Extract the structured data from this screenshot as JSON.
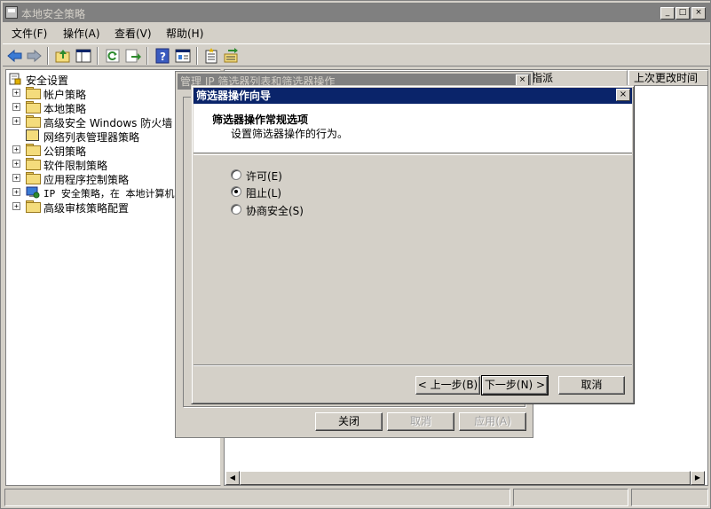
{
  "window": {
    "title": "本地安全策略",
    "min_label": "_",
    "max_label": "□",
    "close_label": "×"
  },
  "menu": [
    {
      "label": "文件(F)"
    },
    {
      "label": "操作(A)"
    },
    {
      "label": "查看(V)"
    },
    {
      "label": "帮助(H)"
    }
  ],
  "tree": {
    "root": "安全设置",
    "items": [
      {
        "label": "帐户策略",
        "expander": "+"
      },
      {
        "label": "本地策略",
        "expander": "+"
      },
      {
        "label": "高级安全 Windows 防火墙",
        "expander": "+"
      },
      {
        "label": "网络列表管理器策略",
        "expander": ""
      },
      {
        "label": "公钥策略",
        "expander": "+"
      },
      {
        "label": "软件限制策略",
        "expander": "+"
      },
      {
        "label": "应用程序控制策略",
        "expander": "+"
      },
      {
        "label": "IP 安全策略，在 本地计算机",
        "expander": "+"
      },
      {
        "label": "高级审核策略配置",
        "expander": "+"
      }
    ]
  },
  "list": {
    "columns": [
      {
        "label": "指派"
      },
      {
        "label": "上次更改时间"
      }
    ]
  },
  "filter_list_dialog": {
    "title": "管理 IP 筛选器列表和筛选器操作",
    "close_label": "×",
    "buttons": {
      "close": "关闭",
      "cancel": "取消",
      "apply": "应用(A)"
    }
  },
  "wizard": {
    "title": "筛选器操作向导",
    "close_label": "×",
    "header_title": "筛选器操作常规选项",
    "header_subtitle": "设置筛选器操作的行为。",
    "options": [
      {
        "label": "许可(E)",
        "checked": false
      },
      {
        "label": "阻止(L)",
        "checked": true
      },
      {
        "label": "协商安全(S)",
        "checked": false
      }
    ],
    "buttons": {
      "back": "< 上一步(B)",
      "next": "下一步(N) >",
      "cancel": "取消"
    }
  },
  "scrollbar": {
    "left_arrow": "◀",
    "right_arrow": "▶"
  }
}
